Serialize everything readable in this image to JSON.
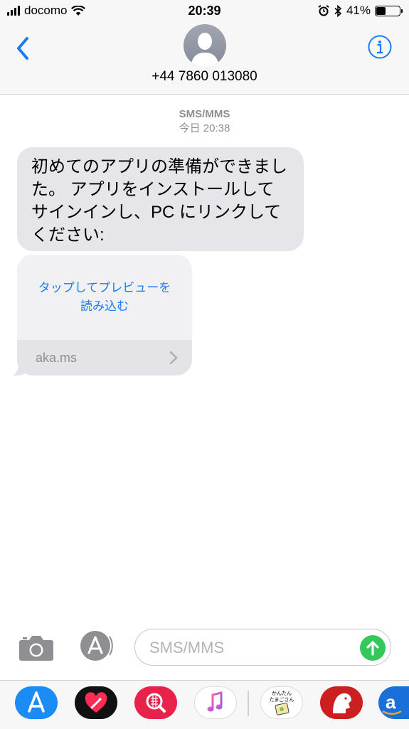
{
  "status_bar": {
    "carrier": "docomo",
    "time": "20:39",
    "battery": "41%",
    "battery_level": 0.41
  },
  "header": {
    "contact": "+44 7860 013080",
    "icons": [
      "back-chevron-icon",
      "contact-avatar-icon",
      "info-icon"
    ]
  },
  "conversation": {
    "service": "SMS/MMS",
    "timestamp": "今日 20:38",
    "message": "初めてのアプリの準備ができました。 アプリをインストールしてサインインし、PC にリンクしてください:",
    "preview": {
      "tap_label": "タップしてプレビューを読み込む",
      "domain": "aka.ms"
    }
  },
  "input": {
    "placeholder": "SMS/MMS",
    "value": ""
  },
  "drawer": {
    "apps": [
      "app-store",
      "digital-touch",
      "search-images",
      "music",
      "sticker-pack",
      "red-app",
      "amazon"
    ],
    "sticker_text_1": "かんたん",
    "sticker_text_2": "たまごさん",
    "amazon_letter": "a"
  },
  "colors": {
    "accent": "#1a7cf4",
    "bubble": "#e5e5ea",
    "send": "#34c759",
    "meta": "#8e8e93"
  }
}
